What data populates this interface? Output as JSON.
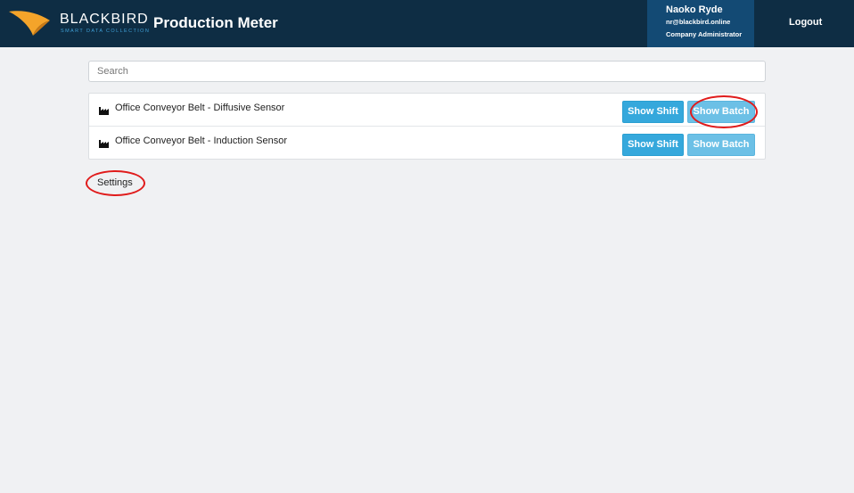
{
  "brand": {
    "name": "BLACKBIRD",
    "tagline": "SMART DATA COLLECTION",
    "logo_color": "#f4a42a"
  },
  "header": {
    "app_title": "Production Meter",
    "user": {
      "name": "Naoko Ryde",
      "email": "nr@blackbird.online",
      "role": "Company Administrator"
    },
    "logout_label": "Logout"
  },
  "search": {
    "placeholder": "Search",
    "value": ""
  },
  "devices": [
    {
      "label": "Office Conveyor Belt - Diffusive Sensor",
      "icon": "factory-icon",
      "shift_label": "Show Shift",
      "batch_label": "Show Batch"
    },
    {
      "label": "Office Conveyor Belt - Induction Sensor",
      "icon": "factory-icon",
      "shift_label": "Show Shift",
      "batch_label": "Show Batch"
    }
  ],
  "settings_label": "Settings",
  "colors": {
    "header_bg": "#0e2d44",
    "user_box_bg": "#134a74",
    "primary_button": "#35a8dc",
    "secondary_button": "#6cc0e6",
    "highlight_ring": "#e01b1b"
  }
}
